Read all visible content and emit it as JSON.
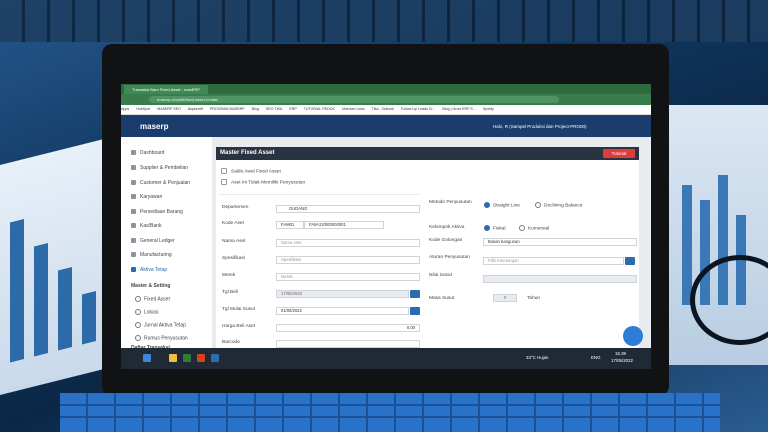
{
  "browser": {
    "tab_title": "Transaksi Baru Fixed Asset - masERP",
    "url": "maserp.cloud/#/fixed-asset-create/",
    "bookmarks": [
      "Apps",
      "HubSpot",
      "MASERP SEO",
      "Aspkerrift",
      "PROGRAM MASERP",
      "Blog",
      "SEO TIKA",
      "ERP",
      "TUTORIAL FBOOK",
      "Ubersee Links",
      "Tika - Outlook",
      "Follow Up Leads Cr...",
      "Blog | Grow ERP S...",
      "Spotify"
    ]
  },
  "app": {
    "brand": "maserp",
    "user": "Halo, R (Sampel Produksi dan Project-PRO00)"
  },
  "sidebar": {
    "items": [
      "Dashboard",
      "Supplier & Pembelian",
      "Customer & Penjualan",
      "Karyawan",
      "Persediaan Barang",
      "Kas/Bank",
      "General Ledger",
      "Manufacturing",
      "Aktiva Tetap"
    ],
    "section": "Master & Setting",
    "sub_items": [
      "Fixed Asset",
      "Lokasi",
      "Jurnal Aktiva Tetap",
      "Rumus Penyusutan"
    ],
    "section2": "Daftar Transaksi"
  },
  "form": {
    "title": "Master Fixed Asset",
    "tutorial_label": "Tutorial",
    "check1": "Saldo Awal Fixed Asset",
    "check2": "Aset Ini Tidak Memiliki Penyusutan",
    "departemen_label": "Departemen",
    "departemen_value": "GUDANG",
    "kode_label": "Kode Aset",
    "kode_prefix": "FAM01",
    "kode_value": "FAM-22/000000001",
    "nama_label": "Nama Aset",
    "nama_placeholder": "Nama Aset",
    "spesifikasi_label": "Spesifikasi",
    "spesifikasi_placeholder": "Spesifikasi",
    "merek_label": "Merek",
    "merek_placeholder": "Merek",
    "tglbeli_label": "Tgl.Beli",
    "tglbeli_value": "17/05/2022",
    "tglsusut_label": "Tgl Mulai Susut",
    "tglsusut_value": "01/06/2022",
    "harga_label": "Harga Beli Aset",
    "harga_value": "0,00",
    "barcode_label": "Barcode",
    "metode_label": "Metode Penyusutan",
    "metode_opt1": "Straight Line",
    "metode_opt2": "Declining Balance",
    "kelompok_label": "Kelompok Aktiva",
    "kelompok_opt1": "Fiskal",
    "kelompok_opt2": "Komersial",
    "golongan_label": "Kode Golongan",
    "golongan_value": "Bukan bangunan",
    "aturan_label": "Aturan Penyusutan",
    "aturan_placeholder": "Pilih Keterangan",
    "nilai_label": "Nilai Susut",
    "masa_label": "Masa Susut",
    "masa_value": "0",
    "masa_unit": "Tahun"
  },
  "taskbar": {
    "weather": "33°C Hujan",
    "lang": "ENG",
    "time": "15.39",
    "date": "17/05/2022"
  }
}
